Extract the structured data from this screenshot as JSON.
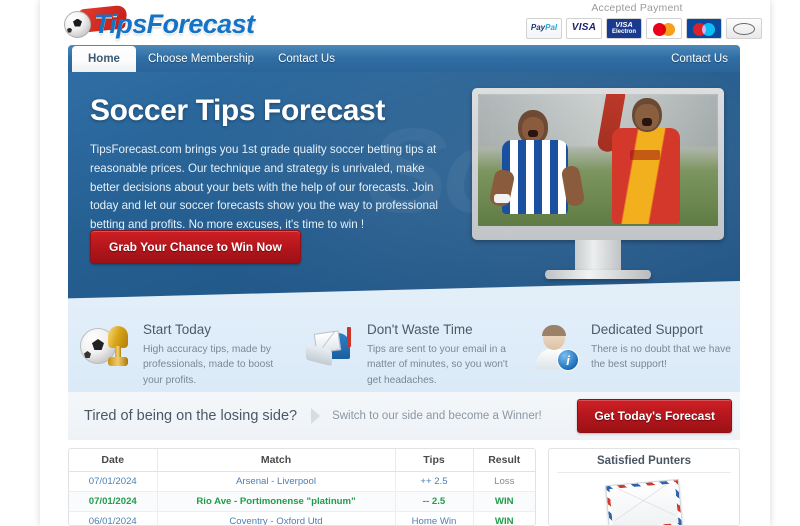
{
  "site": {
    "logo_text_1": "Tips",
    "logo_text_2": "Forecast",
    "ball_icon": "soccer-ball-icon"
  },
  "payments": {
    "title": "Accepted Payment",
    "methods": [
      {
        "name": "paypal",
        "label_a": "Pay",
        "label_b": "Pal"
      },
      {
        "name": "visa",
        "label": "VISA"
      },
      {
        "name": "visa-electron",
        "label_a": "VISA",
        "label_b": "Electron"
      },
      {
        "name": "mastercard",
        "label": "MasterCard"
      },
      {
        "name": "maestro",
        "label": "Maestro"
      },
      {
        "name": "other-card",
        "label": ""
      }
    ]
  },
  "nav": {
    "items": [
      {
        "label": "Home",
        "active": true
      },
      {
        "label": "Choose Membership",
        "active": false
      },
      {
        "label": "Contact Us",
        "active": false
      }
    ],
    "right_label": "Contact Us"
  },
  "hero": {
    "watermark": "Soft",
    "title": "Soccer Tips Forecast",
    "body": "TipsForecast.com brings you 1st grade quality soccer betting tips at reasonable prices. Our technique and strategy is unrivaled, make better decisions about your bets with the help of our forecasts. Join today and let our soccer forecasts show you the way to professional betting and profits. No more excuses, it's time to win !",
    "cta_label": "Grab Your Chance to Win Now",
    "accent_color": "#b3161c",
    "bg_color": "#245d8f"
  },
  "features": [
    {
      "icon": "soccer-ball-trophy-icon",
      "title": "Start Today",
      "desc": "High accuracy tips, made by professionals, made to boost your profits."
    },
    {
      "icon": "mailbox-icon",
      "title": "Don't Waste Time",
      "desc": "Tips are sent to your email in a matter of minutes, so you won't get headaches."
    },
    {
      "icon": "support-person-info-icon",
      "title": "Dedicated Support",
      "desc": "There is no doubt that we have the best support!"
    }
  ],
  "strip": {
    "question": "Tired of being on the losing side?",
    "subtext": "Switch to our side and become a Winner!",
    "button_label": "Get Today's Forecast"
  },
  "results": {
    "columns": [
      "Date",
      "Match",
      "Tips",
      "Result"
    ],
    "rows": [
      {
        "date": "07/01/2024",
        "match": "Arsenal - Liverpool",
        "tips": "++ 2.5",
        "result": "Loss",
        "date_color": "blue",
        "match_color": "blue",
        "tips_color": "blue",
        "result_color": "gray"
      },
      {
        "date": "07/01/2024",
        "match": "Rio Ave - Portimonense \"platinum\"",
        "tips": "-- 2.5",
        "result": "WIN",
        "date_color": "green",
        "match_color": "green",
        "tips_color": "green",
        "result_color": "green"
      },
      {
        "date": "06/01/2024",
        "match": "Coventry - Oxford Utd",
        "tips": "Home Win",
        "result": "WIN",
        "date_color": "blue",
        "match_color": "blue",
        "tips_color": "blue",
        "result_color": "green"
      }
    ]
  },
  "sidebar": {
    "title": "Satisfied Punters",
    "icon": "airmail-envelope-icon"
  }
}
